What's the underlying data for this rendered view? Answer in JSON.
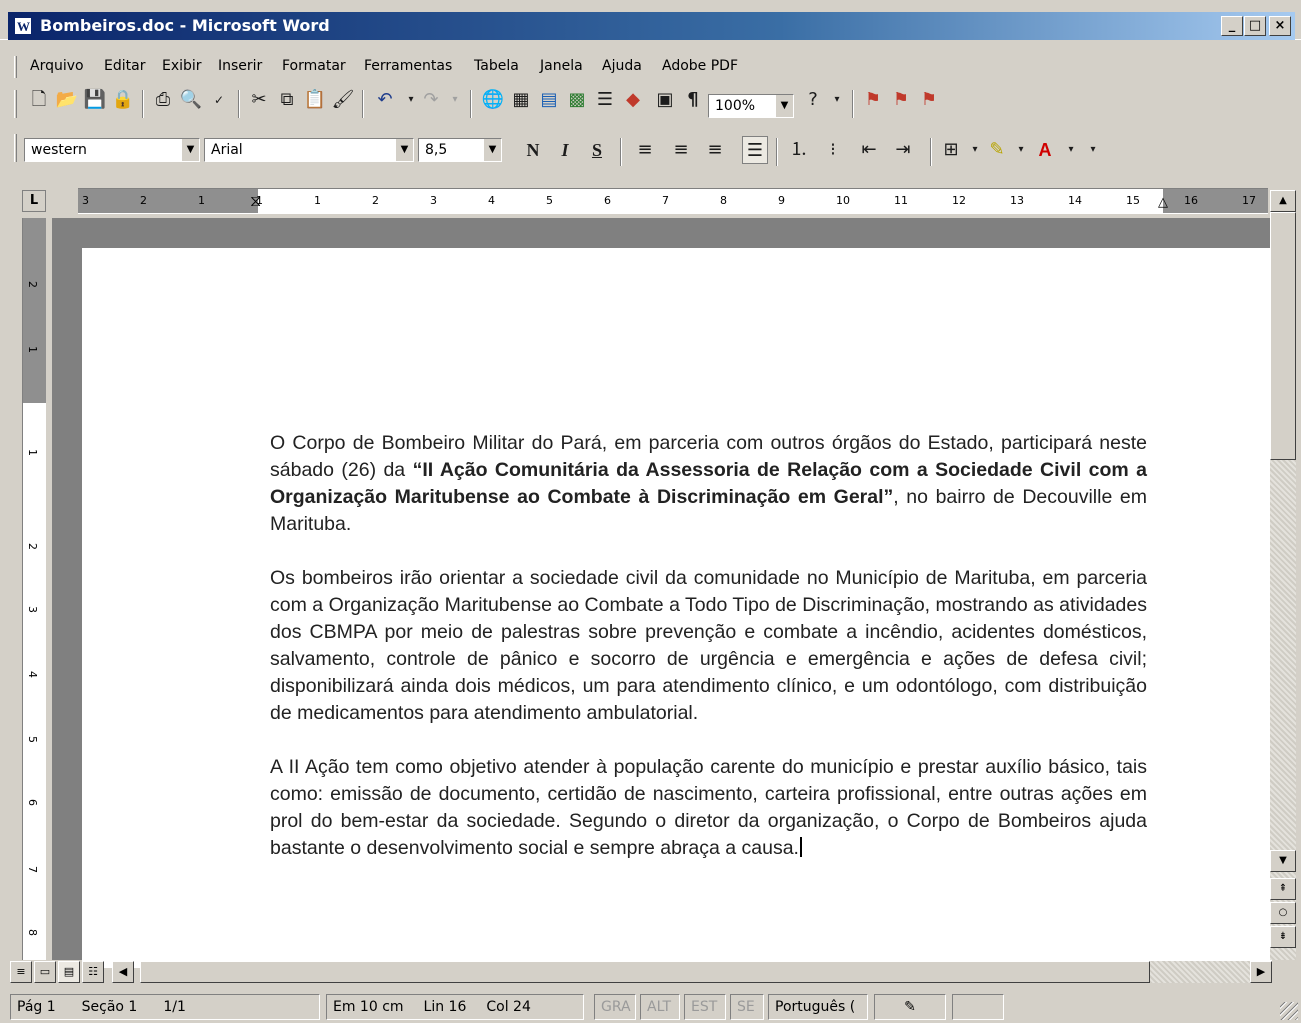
{
  "window": {
    "title": "Bombeiros.doc - Microsoft Word",
    "app_icon": "word-doc-icon",
    "controls": [
      "minimize-icon",
      "maximize-icon",
      "close-icon"
    ]
  },
  "menu": {
    "items": [
      "Arquivo",
      "Editar",
      "Exibir",
      "Inserir",
      "Formatar",
      "Ferramentas",
      "Tabela",
      "Janela",
      "Ajuda",
      "Adobe PDF"
    ]
  },
  "standard_toolbar": {
    "zoom": "100%",
    "icons": [
      "new-document-icon",
      "open-folder-icon",
      "save-icon",
      "permission-icon",
      "print-icon",
      "print-preview-icon",
      "spelling-icon",
      "cut-icon",
      "copy-icon",
      "paste-icon",
      "format-painter-icon",
      "undo-icon",
      "redo-icon",
      "hyperlink-icon",
      "tables-borders-icon",
      "insert-table-icon",
      "insert-excel-icon",
      "columns-icon",
      "drawing-icon",
      "document-map-icon",
      "show-formatting-icon",
      "help-icon",
      "pdf-convert-icon",
      "pdf-email-icon",
      "pdf-review-icon"
    ]
  },
  "formatting_toolbar": {
    "style": "western",
    "font": "Arial",
    "size": "8,5",
    "bold": "N",
    "italic": "I",
    "underline": "S",
    "icons": [
      "align-left-icon",
      "center-icon",
      "align-right-icon",
      "justify-icon",
      "numbering-icon",
      "bullets-icon",
      "decrease-indent-icon",
      "increase-indent-icon",
      "borders-icon",
      "highlight-icon",
      "font-color-icon"
    ]
  },
  "ruler": {
    "corner": "L",
    "labels": [
      "3",
      "2",
      "1",
      "1",
      "1",
      "2",
      "3",
      "4",
      "5",
      "6",
      "7",
      "8",
      "9",
      "10",
      "11",
      "12",
      "13",
      "14",
      "15",
      "16",
      "17"
    ],
    "vertical_labels": [
      "2",
      "1",
      "1",
      "2",
      "3",
      "4",
      "5",
      "6",
      "7",
      "8"
    ]
  },
  "document": {
    "paragraphs": [
      {
        "before": "O Corpo de Bombeiro Militar do Pará, em parceria com outros órgãos do Estado, participará neste sábado (26) da ",
        "bold": "“II Ação Comunitária da Assessoria de Relação com a Sociedade Civil com a Organização Maritubense ao Combate à Discriminação em Geral”",
        "after": ", no bairro de Decouville em Marituba."
      },
      {
        "text": "Os bombeiros irão orientar a sociedade civil da comunidade no Município de Marituba, em parceria com a Organização Maritubense ao Combate a Todo Tipo de Discriminação, mostrando as atividades dos CBMPA por meio de palestras sobre prevenção e combate a incêndio, acidentes domésticos, salvamento, controle de pânico e socorro de urgência e emergência e ações de defesa civil; disponibilizará ainda dois médicos, um para atendimento clínico, e um odontólogo, com distribuição de medicamentos para atendimento ambulatorial."
      },
      {
        "text": "A II Ação tem como objetivo atender à população carente do município e prestar auxílio básico, tais como: emissão de documento, certidão de nascimento, carteira profissional, entre outras ações em prol do bem-estar da sociedade. Segundo o diretor da organização, o Corpo de Bombeiros ajuda bastante o desenvolvimento social e sempre abraça a causa."
      }
    ]
  },
  "status": {
    "page": "Pág 1",
    "section": "Seção 1",
    "pages": "1/1",
    "position": "Em 10 cm",
    "line": "Lin 16",
    "column": "Col 24",
    "modes": [
      "GRA",
      "ALT",
      "EST",
      "SE"
    ],
    "language": "Português (",
    "book_icon": "spelling-status-icon"
  },
  "colors": {
    "title_bar": "#0a246a",
    "chrome": "#d4d0c8",
    "doc_background": "#808080"
  }
}
